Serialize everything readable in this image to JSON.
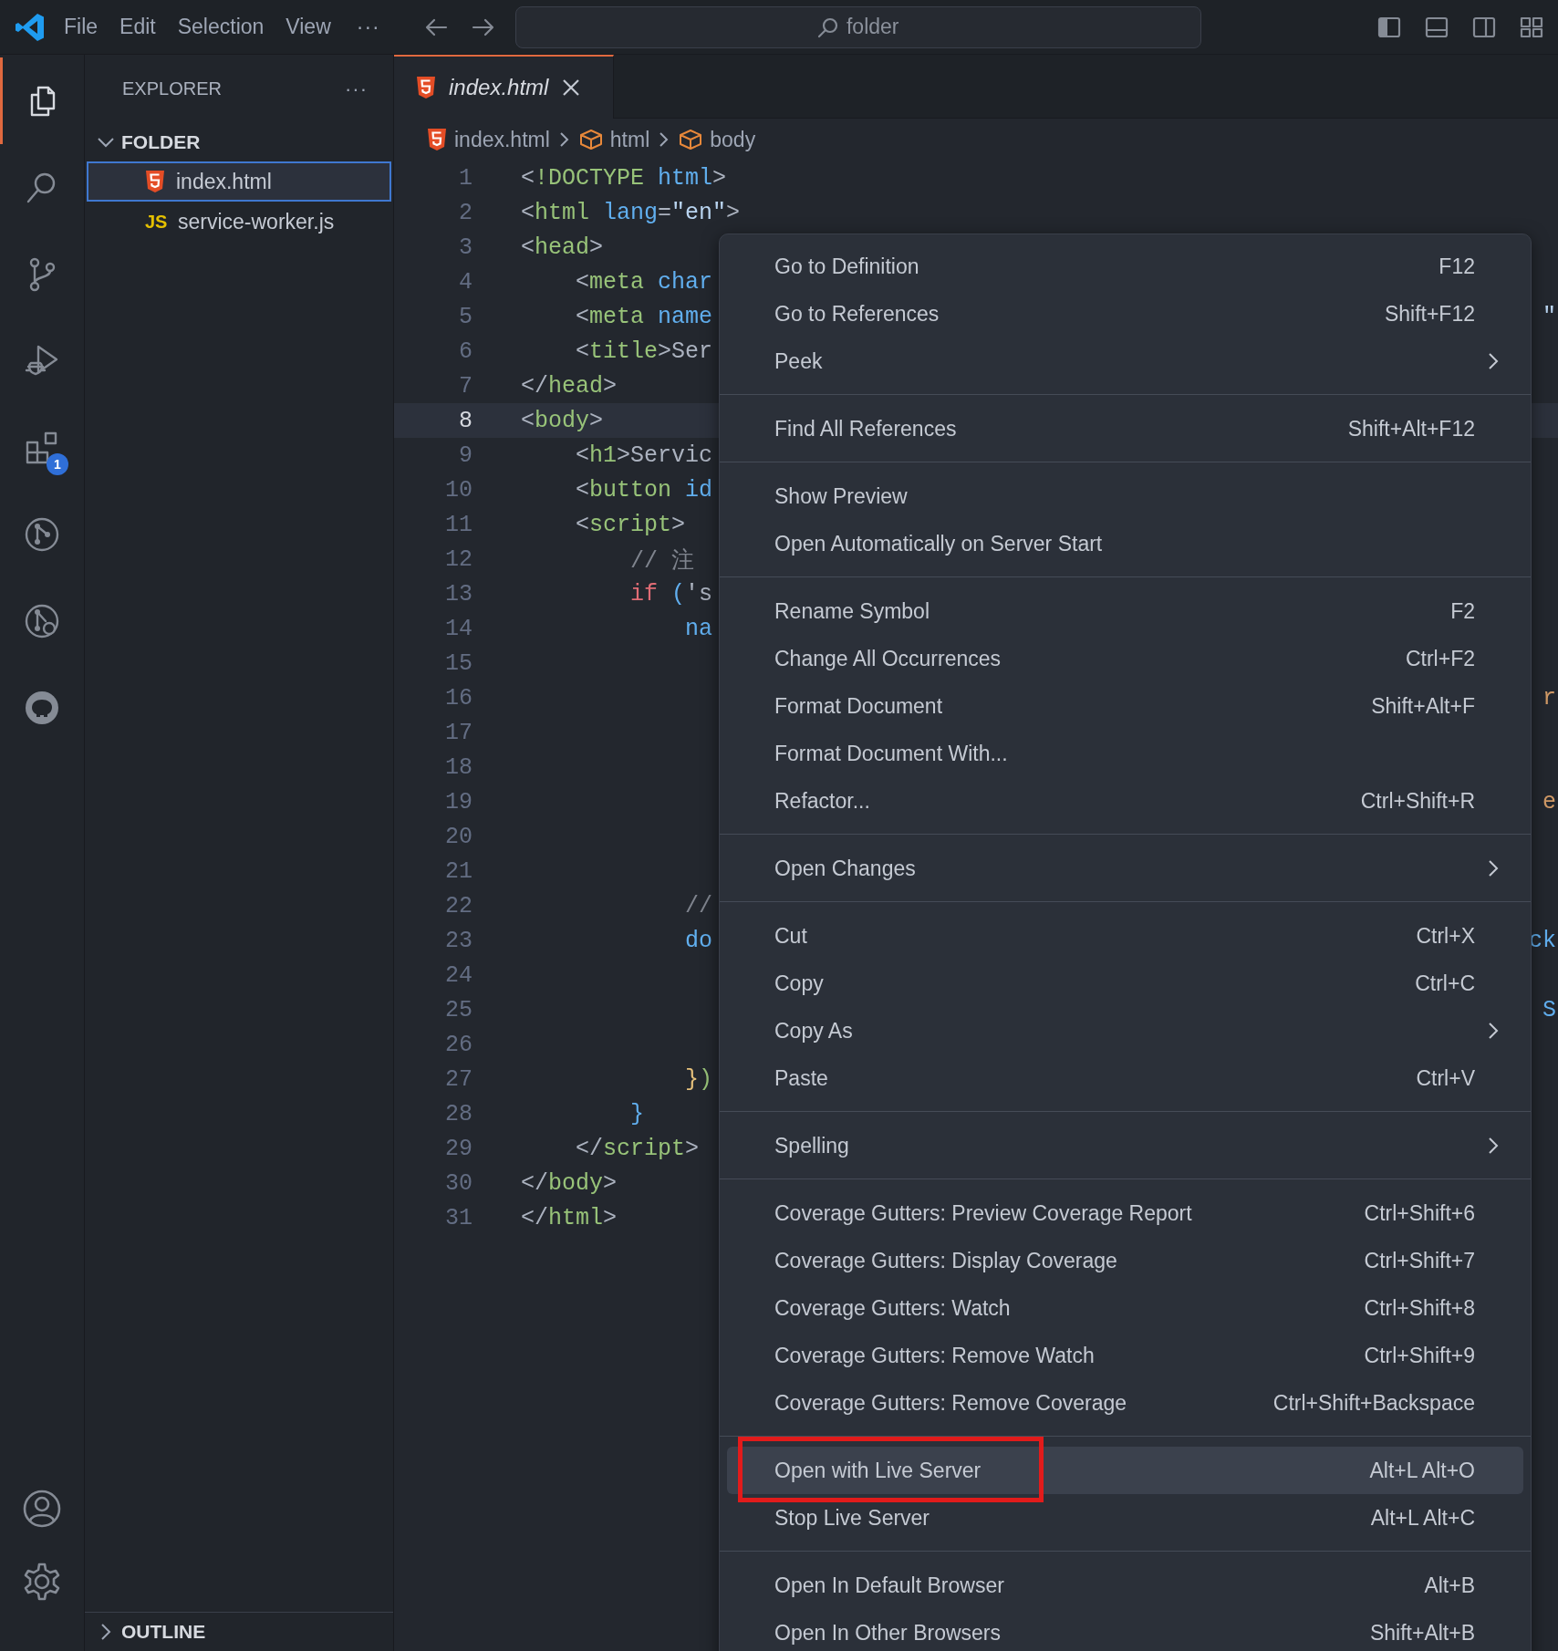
{
  "title_bar": {
    "menus": [
      "File",
      "Edit",
      "Selection",
      "View"
    ],
    "more": "···",
    "command_center": "folder"
  },
  "activity_bar": {
    "items": [
      {
        "selected": true
      },
      {
        "selected": false
      },
      {
        "selected": false
      },
      {
        "selected": false
      },
      {
        "selected": false,
        "badge": "1"
      },
      {
        "selected": false
      },
      {
        "selected": false
      },
      {
        "selected": false
      }
    ]
  },
  "sidebar": {
    "title": "EXPLORER",
    "more": "···",
    "sections": [
      {
        "title": "FOLDER",
        "expanded": true,
        "files": [
          {
            "name": "index.html",
            "selected": true
          },
          {
            "name": "service-worker.js",
            "icon_text": "JS",
            "selected": false
          }
        ]
      },
      {
        "title": "OUTLINE",
        "expanded": false
      }
    ]
  },
  "editor": {
    "tabs": [
      {
        "label": "index.html",
        "selected": true,
        "preview": true
      }
    ],
    "breadcrumbs": [
      {
        "label": "index.html"
      },
      {
        "label": "html"
      },
      {
        "label": "body"
      }
    ],
    "lines": [
      {
        "number": "1",
        "current": false,
        "tokens": [
          {
            "text": "<",
            "kind": "punct"
          },
          {
            "text": "!DOCTYPE",
            "kind": "tag"
          },
          {
            "text": " html",
            "kind": "attr"
          },
          {
            "text": ">",
            "kind": "punct"
          }
        ]
      },
      {
        "number": "2",
        "current": false,
        "tokens": [
          {
            "text": "<",
            "kind": "punct"
          },
          {
            "text": "html",
            "kind": "tag"
          },
          {
            "text": " lang",
            "kind": "attr"
          },
          {
            "text": "=",
            "kind": "punct"
          },
          {
            "text": "\"en\"",
            "kind": "string"
          },
          {
            "text": ">",
            "kind": "punct"
          }
        ]
      },
      {
        "number": "3",
        "current": false,
        "tokens": [
          {
            "text": "<",
            "kind": "punct"
          },
          {
            "text": "head",
            "kind": "tag"
          },
          {
            "text": ">",
            "kind": "punct"
          }
        ]
      },
      {
        "number": "4",
        "current": false,
        "tokens": [
          {
            "text": "    <",
            "kind": "punct"
          },
          {
            "text": "meta",
            "kind": "tag"
          },
          {
            "text": " char",
            "kind": "attr"
          }
        ]
      },
      {
        "number": "5",
        "current": false,
        "tokens": [
          {
            "text": "    <",
            "kind": "punct"
          },
          {
            "text": "meta",
            "kind": "tag"
          },
          {
            "text": " name",
            "kind": "attr"
          }
        ],
        "tail": {
          "text": "\"",
          "kind": "string"
        }
      },
      {
        "number": "6",
        "current": false,
        "tokens": [
          {
            "text": "    <",
            "kind": "punct"
          },
          {
            "text": "title",
            "kind": "tag"
          },
          {
            "text": ">",
            "kind": "punct"
          },
          {
            "text": "Ser",
            "kind": "text"
          }
        ]
      },
      {
        "number": "7",
        "current": false,
        "tokens": [
          {
            "text": "</",
            "kind": "punct"
          },
          {
            "text": "head",
            "kind": "tag"
          },
          {
            "text": ">",
            "kind": "punct"
          }
        ]
      },
      {
        "number": "8",
        "current": true,
        "tokens": [
          {
            "text": "<",
            "kind": "punct"
          },
          {
            "text": "body",
            "kind": "tag"
          },
          {
            "text": ">",
            "kind": "punct"
          }
        ]
      },
      {
        "number": "9",
        "current": false,
        "tokens": [
          {
            "text": "    <",
            "kind": "punct"
          },
          {
            "text": "h1",
            "kind": "tag"
          },
          {
            "text": ">",
            "kind": "punct"
          },
          {
            "text": "Servic",
            "kind": "text"
          }
        ]
      },
      {
        "number": "10",
        "current": false,
        "tokens": [
          {
            "text": "    <",
            "kind": "punct"
          },
          {
            "text": "button",
            "kind": "tag"
          },
          {
            "text": " id",
            "kind": "attr"
          }
        ]
      },
      {
        "number": "11",
        "current": false,
        "tokens": [
          {
            "text": "    <",
            "kind": "punct"
          },
          {
            "text": "script",
            "kind": "tag"
          },
          {
            "text": ">",
            "kind": "punct"
          }
        ]
      },
      {
        "number": "12",
        "current": false,
        "tokens": [
          {
            "text": "        // 注",
            "kind": "comment"
          }
        ]
      },
      {
        "number": "13",
        "current": false,
        "tokens": [
          {
            "text": "        if",
            "kind": "keyword"
          },
          {
            "text": " (",
            "kind": "bracket_blue"
          },
          {
            "text": "'s",
            "kind": "text"
          }
        ]
      },
      {
        "number": "14",
        "current": false,
        "tokens": [
          {
            "text": "            na",
            "kind": "attr"
          }
        ]
      },
      {
        "number": "15",
        "current": false
      },
      {
        "number": "16",
        "current": false,
        "tail": {
          "text": "r",
          "kind": "property"
        }
      },
      {
        "number": "17",
        "current": false
      },
      {
        "number": "18",
        "current": false
      },
      {
        "number": "19",
        "current": false,
        "tail": {
          "text": "e",
          "kind": "property"
        }
      },
      {
        "number": "20",
        "current": false
      },
      {
        "number": "21",
        "current": false
      },
      {
        "number": "22",
        "current": false,
        "tokens": [
          {
            "text": "            //",
            "kind": "comment"
          }
        ]
      },
      {
        "number": "23",
        "current": false,
        "tokens": [
          {
            "text": "            do",
            "kind": "attr"
          }
        ],
        "tail": {
          "text": "ck",
          "kind": "attr"
        }
      },
      {
        "number": "24",
        "current": false
      },
      {
        "number": "25",
        "current": false,
        "tail": {
          "text": "S",
          "kind": "attr"
        }
      },
      {
        "number": "26",
        "current": false
      },
      {
        "number": "27",
        "current": false,
        "tokens": [
          {
            "text": "            }",
            "kind": "bracket_gold"
          },
          {
            "text": ")",
            "kind": "tag"
          }
        ]
      },
      {
        "number": "28",
        "current": false,
        "tokens": [
          {
            "text": "        }",
            "kind": "bracket_blue"
          }
        ]
      },
      {
        "number": "29",
        "current": false,
        "tokens": [
          {
            "text": "    </",
            "kind": "punct"
          },
          {
            "text": "script",
            "kind": "tag"
          },
          {
            "text": ">",
            "kind": "punct"
          }
        ]
      },
      {
        "number": "30",
        "current": false,
        "tokens": [
          {
            "text": "</",
            "kind": "punct"
          },
          {
            "text": "body",
            "kind": "tag"
          },
          {
            "text": ">",
            "kind": "punct"
          }
        ]
      },
      {
        "number": "31",
        "current": false,
        "tokens": [
          {
            "text": "</",
            "kind": "punct"
          },
          {
            "text": "html",
            "kind": "tag"
          },
          {
            "text": ">",
            "kind": "punct"
          }
        ]
      }
    ]
  },
  "context_menu": {
    "groups": [
      [
        {
          "label": "Go to Definition",
          "shortcut": "F12",
          "submenu": false,
          "selected": false,
          "annotated": false
        },
        {
          "label": "Go to References",
          "shortcut": "Shift+F12",
          "submenu": false,
          "selected": false,
          "annotated": false
        },
        {
          "label": "Peek",
          "submenu": true,
          "selected": false,
          "annotated": false
        }
      ],
      [
        {
          "label": "Find All References",
          "shortcut": "Shift+Alt+F12",
          "submenu": false,
          "selected": false,
          "annotated": false
        }
      ],
      [
        {
          "label": "Show Preview",
          "submenu": false,
          "selected": false,
          "annotated": false
        },
        {
          "label": "Open Automatically on Server Start",
          "submenu": false,
          "selected": false,
          "annotated": false
        }
      ],
      [
        {
          "label": "Rename Symbol",
          "shortcut": "F2",
          "submenu": false,
          "selected": false,
          "annotated": false
        },
        {
          "label": "Change All Occurrences",
          "shortcut": "Ctrl+F2",
          "submenu": false,
          "selected": false,
          "annotated": false
        },
        {
          "label": "Format Document",
          "shortcut": "Shift+Alt+F",
          "submenu": false,
          "selected": false,
          "annotated": false
        },
        {
          "label": "Format Document With...",
          "submenu": false,
          "selected": false,
          "annotated": false
        },
        {
          "label": "Refactor...",
          "shortcut": "Ctrl+Shift+R",
          "submenu": false,
          "selected": false,
          "annotated": false
        }
      ],
      [
        {
          "label": "Open Changes",
          "submenu": true,
          "selected": false,
          "annotated": false
        }
      ],
      [
        {
          "label": "Cut",
          "shortcut": "Ctrl+X",
          "submenu": false,
          "selected": false,
          "annotated": false
        },
        {
          "label": "Copy",
          "shortcut": "Ctrl+C",
          "submenu": false,
          "selected": false,
          "annotated": false
        },
        {
          "label": "Copy As",
          "submenu": true,
          "selected": false,
          "annotated": false
        },
        {
          "label": "Paste",
          "shortcut": "Ctrl+V",
          "submenu": false,
          "selected": false,
          "annotated": false
        }
      ],
      [
        {
          "label": "Spelling",
          "submenu": true,
          "selected": false,
          "annotated": false
        }
      ],
      [
        {
          "label": "Coverage Gutters: Preview Coverage Report",
          "shortcut": "Ctrl+Shift+6",
          "submenu": false,
          "selected": false,
          "annotated": false
        },
        {
          "label": "Coverage Gutters: Display Coverage",
          "shortcut": "Ctrl+Shift+7",
          "submenu": false,
          "selected": false,
          "annotated": false
        },
        {
          "label": "Coverage Gutters: Watch",
          "shortcut": "Ctrl+Shift+8",
          "submenu": false,
          "selected": false,
          "annotated": false
        },
        {
          "label": "Coverage Gutters: Remove Watch",
          "shortcut": "Ctrl+Shift+9",
          "submenu": false,
          "selected": false,
          "annotated": false
        },
        {
          "label": "Coverage Gutters: Remove Coverage",
          "shortcut": "Ctrl+Shift+Backspace",
          "submenu": false,
          "selected": false,
          "annotated": false
        }
      ],
      [
        {
          "label": "Open with Live Server",
          "shortcut": "Alt+L Alt+O",
          "submenu": false,
          "selected": true,
          "annotated": true
        },
        {
          "label": "Stop Live Server",
          "shortcut": "Alt+L Alt+C",
          "submenu": false,
          "selected": false,
          "annotated": false
        }
      ],
      [
        {
          "label": "Open In Default Browser",
          "shortcut": "Alt+B",
          "submenu": false,
          "selected": false,
          "annotated": false
        },
        {
          "label": "Open In Other Browsers",
          "shortcut": "Shift+Alt+B",
          "submenu": false,
          "selected": false,
          "annotated": false
        }
      ]
    ]
  }
}
